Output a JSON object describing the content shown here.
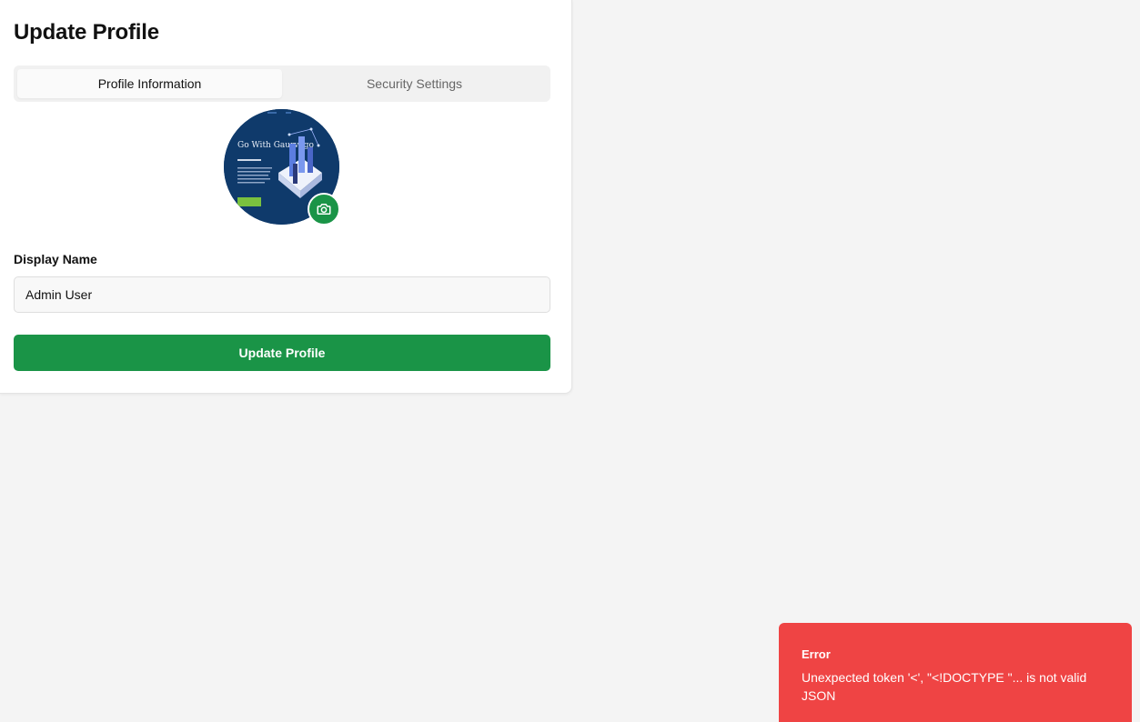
{
  "page": {
    "title": "Update Profile"
  },
  "tabs": [
    {
      "label": "Profile Information",
      "active": true
    },
    {
      "label": "Security Settings",
      "active": false
    }
  ],
  "avatar": {
    "image_text": "Go With Gaurvego",
    "camera_icon": "camera-icon"
  },
  "form": {
    "display_name_label": "Display Name",
    "display_name_value": "Admin User",
    "submit_label": "Update Profile"
  },
  "toast": {
    "title": "Error",
    "message": "Unexpected token '<', \"<!DOCTYPE \"... is not valid JSON"
  },
  "colors": {
    "accent": "#1a9447",
    "error": "#ef4444",
    "avatar_bg": "#0f3a6b"
  }
}
